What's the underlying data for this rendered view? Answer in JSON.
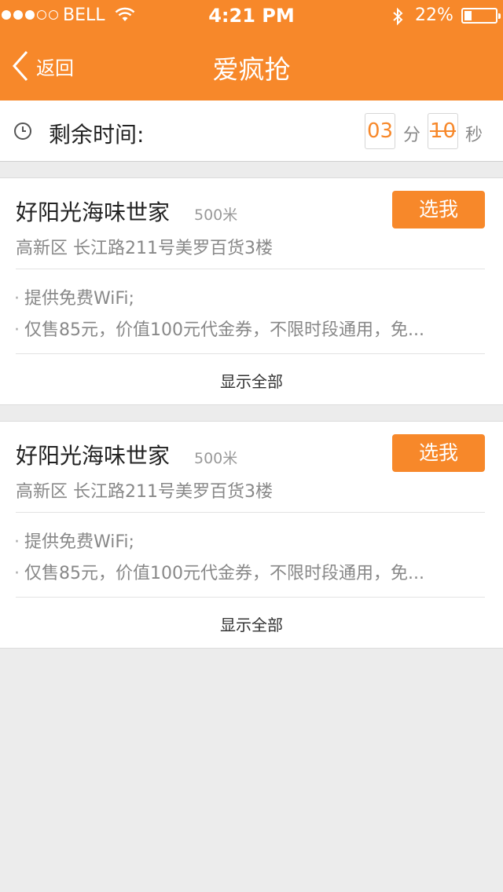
{
  "status_bar": {
    "carrier": "BELL",
    "time": "4:21 PM",
    "battery": "22%"
  },
  "nav": {
    "back_label": "返回",
    "title": "爱疯抢"
  },
  "timer": {
    "label": "剩余时间:",
    "minutes": "03",
    "minute_unit": "分",
    "seconds": "10",
    "second_unit": "秒"
  },
  "colors": {
    "accent": "#f7882a",
    "background": "#ececec"
  },
  "deals": [
    {
      "name": "好阳光海味世家",
      "distance": "500米",
      "button": "选我",
      "address": "高新区 长江路211号美罗百货3楼",
      "features": [
        "提供免费WiFi;",
        "仅售85元，价值100元代金券，不限时段通用，免..."
      ],
      "show_all": "显示全部"
    },
    {
      "name": "好阳光海味世家",
      "distance": "500米",
      "button": "选我",
      "address": "高新区 长江路211号美罗百货3楼",
      "features": [
        "提供免费WiFi;",
        "仅售85元，价值100元代金券，不限时段通用，免..."
      ],
      "show_all": "显示全部"
    }
  ]
}
